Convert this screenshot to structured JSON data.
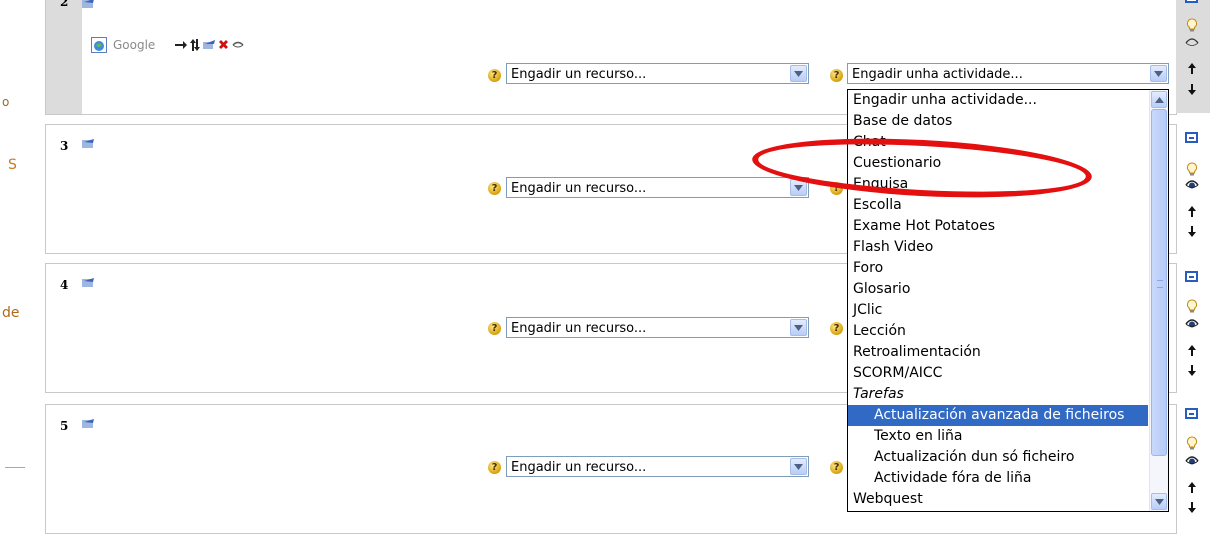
{
  "left_fragments": [
    "o",
    "S",
    "de"
  ],
  "sections": [
    {
      "number": "2"
    },
    {
      "number": "3"
    },
    {
      "number": "4"
    },
    {
      "number": "5"
    }
  ],
  "google_resource": {
    "label": "Google"
  },
  "resource_select": {
    "value": "Engadir un recurso..."
  },
  "activity_select": {
    "value": "Engadir unha actividade..."
  },
  "help_glyph": "?",
  "activity_options": [
    {
      "label": "Engadir unha actividade...",
      "kind": "item"
    },
    {
      "label": "Base de datos",
      "kind": "item"
    },
    {
      "label": "Chat",
      "kind": "item"
    },
    {
      "label": "Cuestionario",
      "kind": "item"
    },
    {
      "label": "Enquisa",
      "kind": "item"
    },
    {
      "label": "Escolla",
      "kind": "item"
    },
    {
      "label": "Exame Hot Potatoes",
      "kind": "item"
    },
    {
      "label": "Flash Video",
      "kind": "item"
    },
    {
      "label": "Foro",
      "kind": "item"
    },
    {
      "label": "Glosario",
      "kind": "item"
    },
    {
      "label": "JClic",
      "kind": "item"
    },
    {
      "label": "Lección",
      "kind": "item"
    },
    {
      "label": "Retroalimentación",
      "kind": "item"
    },
    {
      "label": "SCORM/AICC",
      "kind": "item"
    },
    {
      "label": "Tarefas",
      "kind": "group"
    },
    {
      "label": "Actualización avanzada de ficheiros",
      "kind": "sub",
      "selected": true
    },
    {
      "label": "Texto en liña",
      "kind": "sub"
    },
    {
      "label": "Actualización dun só ficheiro",
      "kind": "sub"
    },
    {
      "label": "Actividade fóra de liña",
      "kind": "sub"
    },
    {
      "label": "Webquest",
      "kind": "item"
    }
  ],
  "colors": {
    "annotation": "#e41010",
    "selection": "#316ac5",
    "section_bar": "#dcdcdc"
  },
  "icons": [
    "edit-icon",
    "move-icon",
    "delete-icon",
    "hide-icon",
    "help-icon",
    "collapse-icon",
    "highlight-icon",
    "eye-icon",
    "move-up-icon",
    "move-down-icon"
  ]
}
